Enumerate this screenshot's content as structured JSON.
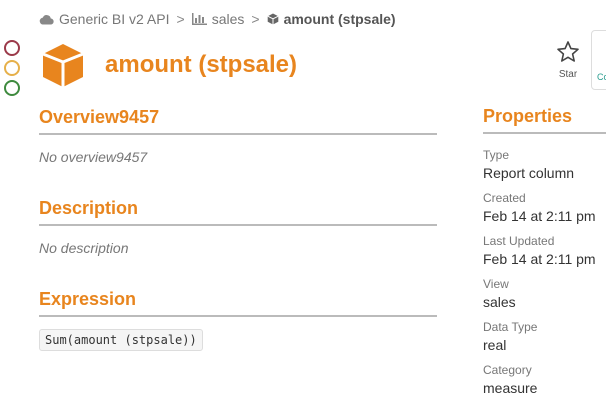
{
  "breadcrumb": {
    "api": "Generic BI v2 API",
    "view": "sales",
    "current": "amount (stpsale)",
    "separator": ">"
  },
  "title": "amount (stpsale)",
  "star_label": "Star",
  "edge_panel_text": "Co",
  "overview": {
    "heading": "Overview9457",
    "text": "No overview9457"
  },
  "description": {
    "heading": "Description",
    "text": "No description"
  },
  "expression": {
    "heading": "Expression",
    "code": "Sum(amount (stpsale))"
  },
  "properties": {
    "heading": "Properties",
    "items": [
      {
        "key": "Type",
        "value": "Report column"
      },
      {
        "key": "Created",
        "value": "Feb 14 at 2:11 pm"
      },
      {
        "key": "Last Updated",
        "value": "Feb 14 at 2:11 pm"
      },
      {
        "key": "View",
        "value": "sales"
      },
      {
        "key": "Data Type",
        "value": "real"
      },
      {
        "key": "Category",
        "value": "measure"
      }
    ]
  },
  "colors": {
    "accent": "#e8851e",
    "circle_red": "#9b3a4a",
    "circle_yellow": "#e6b04a",
    "circle_green": "#3e8a3e"
  },
  "icons": {
    "api": "cloud-icon",
    "view": "bar-chart-icon",
    "current": "cube-icon",
    "header": "cube-icon",
    "star": "star-icon"
  }
}
